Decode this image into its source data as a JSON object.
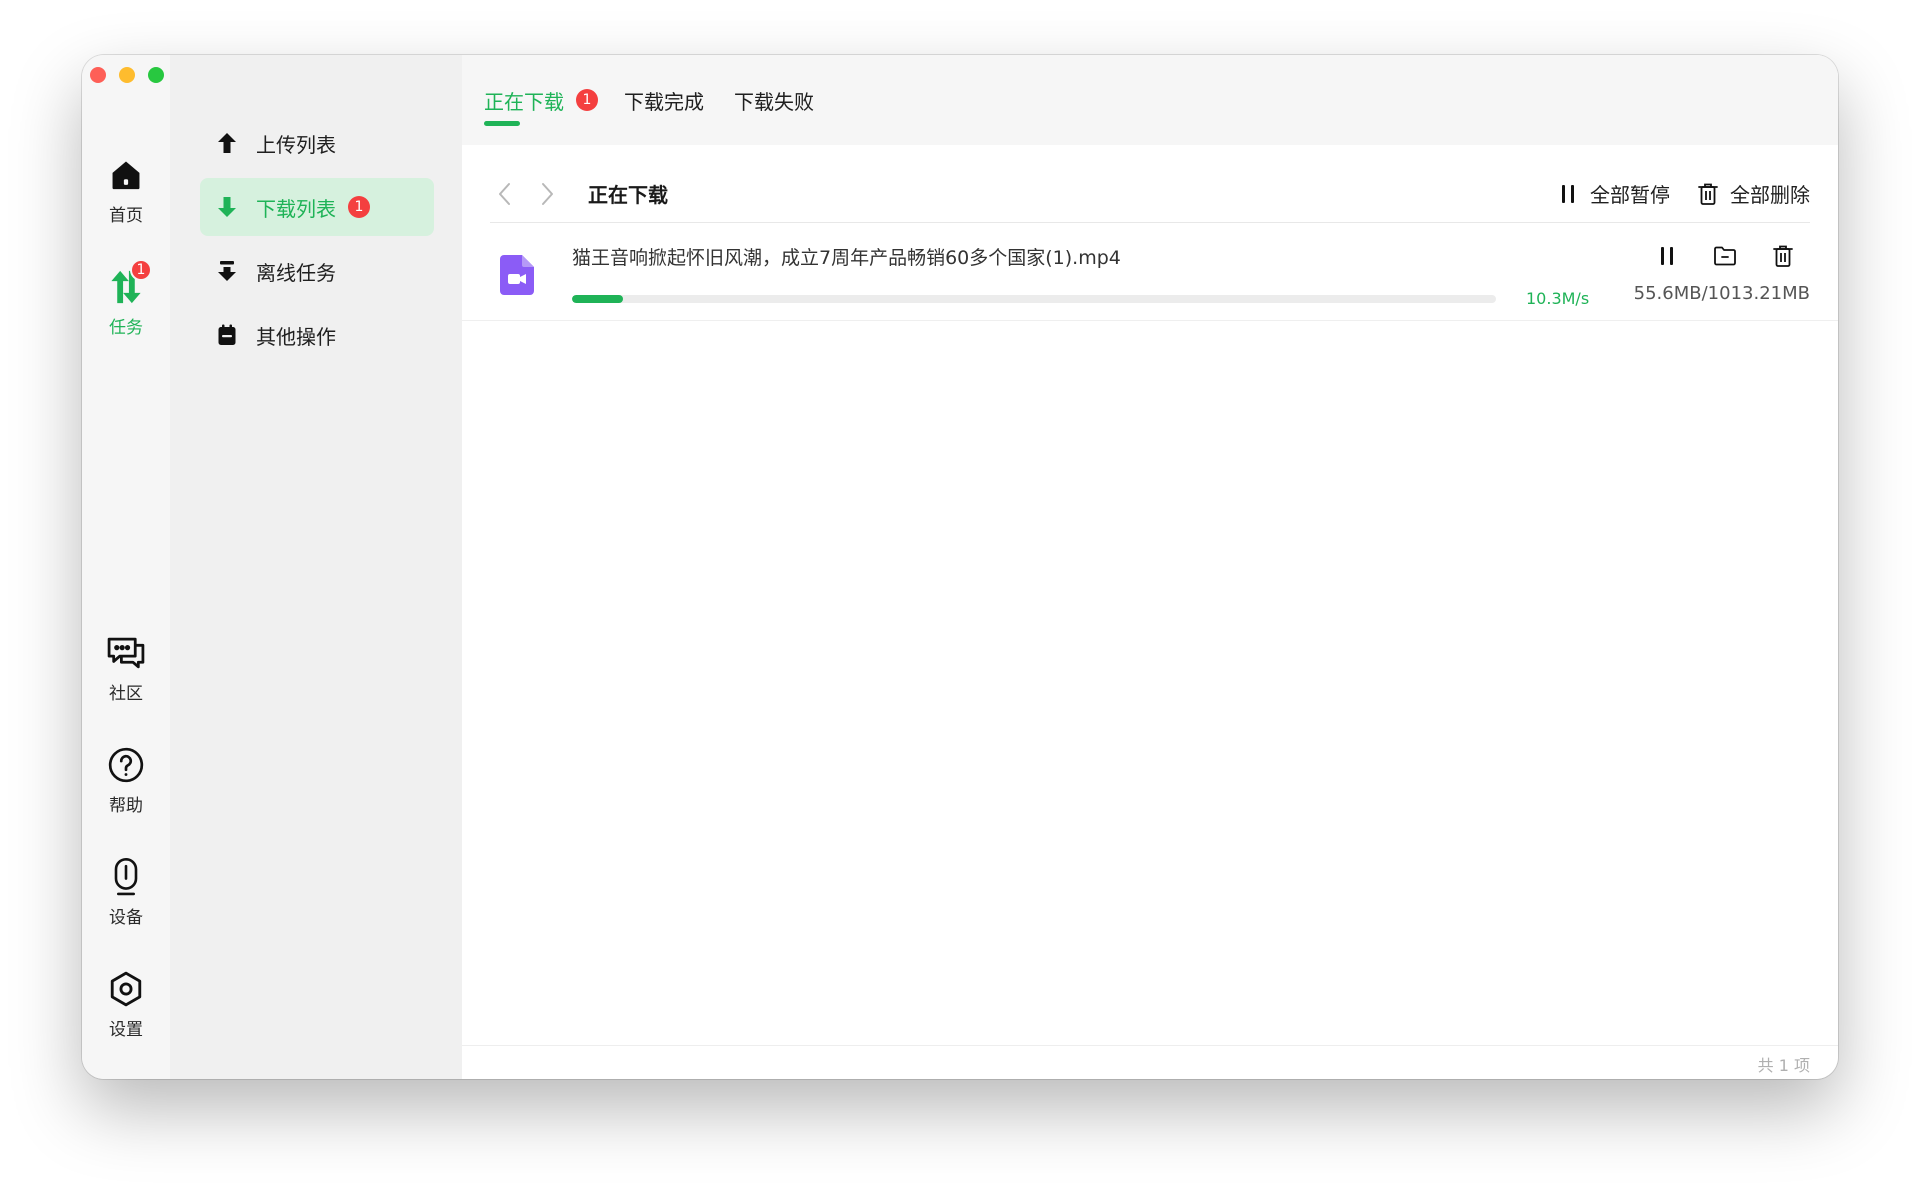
{
  "window": {
    "traffic_lights": [
      "close",
      "minimize",
      "maximize"
    ]
  },
  "rail": {
    "items": [
      {
        "label": "首页",
        "icon": "home-icon"
      },
      {
        "label": "任务",
        "icon": "transfer-icon",
        "badge": "1",
        "active": true
      },
      {
        "label": "社区",
        "icon": "chat-icon"
      },
      {
        "label": "帮助",
        "icon": "help-icon"
      },
      {
        "label": "设备",
        "icon": "device-icon"
      },
      {
        "label": "设置",
        "icon": "settings-icon"
      }
    ]
  },
  "subnav": {
    "items": [
      {
        "label": "上传列表",
        "icon": "upload-arrow-icon"
      },
      {
        "label": "下载列表",
        "icon": "download-arrow-icon",
        "badge": "1",
        "active": true
      },
      {
        "label": "离线任务",
        "icon": "offline-download-icon"
      },
      {
        "label": "其他操作",
        "icon": "calendar-icon"
      }
    ]
  },
  "tabs": [
    {
      "label": "正在下载",
      "badge": "1",
      "active": true
    },
    {
      "label": "下载完成"
    },
    {
      "label": "下载失败"
    }
  ],
  "toolbar": {
    "title": "正在下载",
    "pause_all": "全部暂停",
    "delete_all": "全部删除"
  },
  "downloads": [
    {
      "file_name": "猫王音响掀起怀旧风潮，成立7周年产品畅销60多个国家(1).mp4",
      "progress": 0.055,
      "speed": "10.3M/s",
      "size": "55.6MB/1013.21MB",
      "icon": "video-file-icon"
    }
  ],
  "footer": {
    "count": "共 1 项"
  },
  "colors": {
    "accent": "#1fb357",
    "badge": "#f43f3f",
    "active_bg": "#d6f1de",
    "file_icon": "#8b5cf6"
  }
}
